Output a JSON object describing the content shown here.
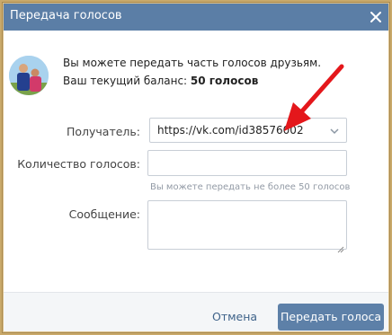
{
  "dialog": {
    "title": "Передача голосов",
    "close_icon": "close-icon"
  },
  "info": {
    "line1": "Вы можете передать часть голосов друзьям.",
    "balance_label": "Ваш текущий баланс: ",
    "balance_value": "50 голосов"
  },
  "form": {
    "recipient_label": "Получатель:",
    "recipient_value": "https://vk.com/id38576002",
    "count_label": "Количество голосов:",
    "count_value": "",
    "count_hint": "Вы можете передать не более 50 голосов",
    "message_label": "Сообщение:",
    "message_value": ""
  },
  "footer": {
    "cancel_label": "Отмена",
    "send_label": "Передать голоса"
  },
  "colors": {
    "titlebar": "#5b7ea6",
    "primary_button": "#5d80a8",
    "link": "#3e6289",
    "annotation_arrow": "#e4171b"
  }
}
